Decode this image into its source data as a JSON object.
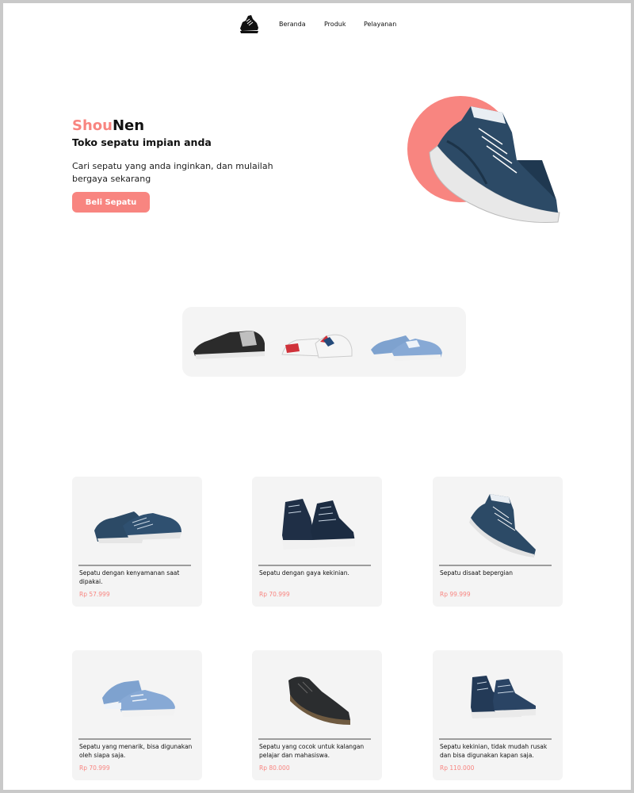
{
  "nav": {
    "logo_icon": "sneaker-logo-icon",
    "links": [
      "Beranda",
      "Produk",
      "Pelayanan"
    ]
  },
  "hero": {
    "brand_part1": "Shou",
    "brand_part2": "Nen",
    "tagline": "Toko sepatu impian anda",
    "description": "Cari sepatu yang anda inginkan, dan mulailah bergaya sekarang",
    "cta_label": "Beli Sepatu",
    "image_icon": "blue-high-top-sneaker"
  },
  "strip": {
    "items": [
      "black-sneaker",
      "red-white-sneaker",
      "light-blue-sneaker"
    ]
  },
  "products": [
    {
      "title": "Sepatu dengan kenyamanan saat dipakai.",
      "price": "Rp 57.999",
      "image": "navy-low-sneaker"
    },
    {
      "title": "Sepatu dengan gaya kekinian.",
      "price": "Rp 70.999",
      "image": "navy-canvas-high-top"
    },
    {
      "title": "Sepatu disaat bepergian",
      "price": "Rp 99.999",
      "image": "blue-high-top-sneaker"
    },
    {
      "title": "Sepatu yang menarik, bisa digunakan oleh siapa saja.",
      "price": "Rp 70.999",
      "image": "light-blue-sneaker"
    },
    {
      "title": "Sepatu yang cocok untuk kalangan pelajar dan mahasiswa.",
      "price": "Rp 80.000",
      "image": "black-leather-shoe"
    },
    {
      "title": "Sepatu kekinian, tidak mudah rusak dan bisa digunakan kapan saja.",
      "price": "Rp 110.000",
      "image": "navy-leather-boot"
    }
  ],
  "colors": {
    "accent": "#f88580",
    "card_bg": "#f4f4f4",
    "shoe_navy": "#2c4a66"
  }
}
